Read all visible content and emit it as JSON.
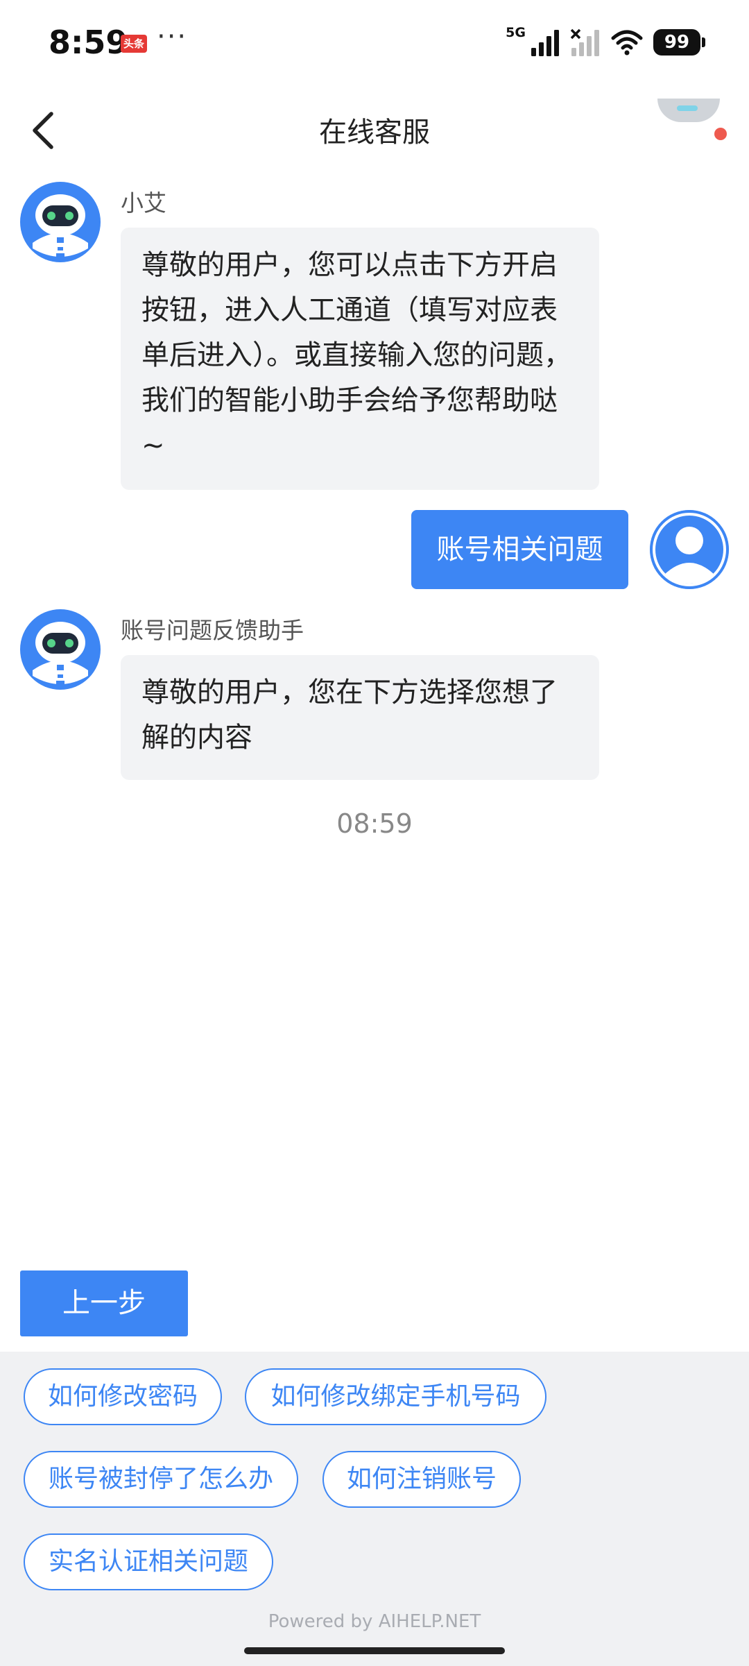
{
  "status_bar": {
    "time": "8:59",
    "app_badge": "头条",
    "more": "···",
    "network": "5G",
    "battery": "99"
  },
  "header": {
    "title": "在线客服"
  },
  "messages": [
    {
      "sender": "小艾",
      "text": "尊敬的用户，您可以点击下方开启按钮，进入人工通道（填写对应表单后进入）。或直接输入您的问题，我们的智能小助手会给予您帮助哒~"
    },
    {
      "user_text": "账号相关问题"
    },
    {
      "sender": "账号问题反馈助手",
      "text": "尊敬的用户，您在下方选择您想了解的内容"
    }
  ],
  "timestamp": "08:59",
  "prev_button": "上一步",
  "options": [
    "如何修改密码",
    "如何修改绑定手机号码",
    "账号被封停了怎么办",
    "如何注销账号",
    "实名认证相关问题"
  ],
  "powered_by": "Powered by AIHELP.NET",
  "colors": {
    "accent": "#3d86f4",
    "bot_bubble": "#f2f3f5",
    "options_bg": "#f0f1f3",
    "notification_dot": "#ee5a4f"
  }
}
